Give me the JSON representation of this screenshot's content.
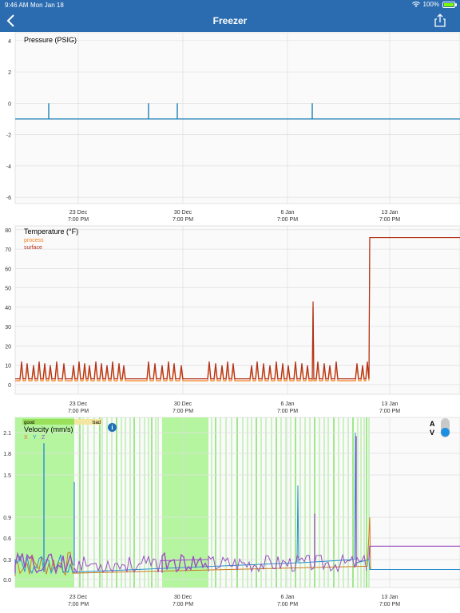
{
  "status_bar": {
    "time": "9:46 AM",
    "date": "Mon Jan 18",
    "battery": "100%"
  },
  "nav": {
    "title": "Freezer"
  },
  "x_ticks": [
    {
      "date": "23 Dec",
      "time": "7:00 PM"
    },
    {
      "date": "30 Dec",
      "time": "7:00 PM"
    },
    {
      "date": "6 Jan",
      "time": "7:00 PM"
    },
    {
      "date": "13 Jan",
      "time": "7:00 PM"
    }
  ],
  "pressure": {
    "title": "Pressure (PSIG)",
    "color": "#1f7fb4"
  },
  "temperature": {
    "title": "Temperature (°F)",
    "process_label": "process",
    "surface_label": "surface",
    "process_color": "#f58220",
    "surface_color": "#b0301a"
  },
  "velocity": {
    "title": "Velocity (mm/s)",
    "good_label": "good",
    "bad_label": "bad",
    "axis_x": "X",
    "axis_y": "Y",
    "axis_z": "Z",
    "toggle_a": "A",
    "toggle_v": "V",
    "info": "i"
  },
  "chart_data": [
    {
      "type": "line",
      "title": "Pressure (PSIG)",
      "x": [
        "23 Dec 7:00 PM",
        "30 Dec 7:00 PM",
        "6 Jan 7:00 PM",
        "13 Jan 7:00 PM"
      ],
      "ylim": [
        -6.4,
        4.5
      ],
      "y_ticks": [
        4,
        2,
        0,
        -2,
        -4,
        -6
      ],
      "baseline": -1,
      "spikes_to": 0,
      "grid": true
    },
    {
      "type": "line",
      "title": "Temperature (°F)",
      "x": [
        "23 Dec 7:00 PM",
        "30 Dec 7:00 PM",
        "6 Jan 7:00 PM",
        "13 Jan 7:00 PM"
      ],
      "ylim": [
        -5,
        82
      ],
      "y_ticks": [
        80,
        70,
        60,
        50,
        40,
        30,
        20,
        10,
        0
      ],
      "series": [
        {
          "name": "process",
          "baseline": 2,
          "cycle_peak": 10,
          "final": 76
        },
        {
          "name": "surface",
          "baseline": 3,
          "cycle_peak": 12,
          "max_spike": 43,
          "final": 76
        }
      ],
      "legend": "top-left",
      "grid": true
    },
    {
      "type": "line",
      "title": "Velocity (mm/s)",
      "x": [
        "23 Dec 7:00 PM",
        "30 Dec 7:00 PM",
        "6 Jan 7:00 PM",
        "13 Jan 7:00 PM"
      ],
      "y_ticks": [
        2.1,
        1.8,
        1.5,
        0.9,
        0.6,
        0.3,
        0.0
      ],
      "series": [
        {
          "name": "X",
          "final": 0.15
        },
        {
          "name": "Y",
          "final": 0.15
        },
        {
          "name": "Z",
          "final": 0.5
        }
      ],
      "grid": true
    }
  ]
}
